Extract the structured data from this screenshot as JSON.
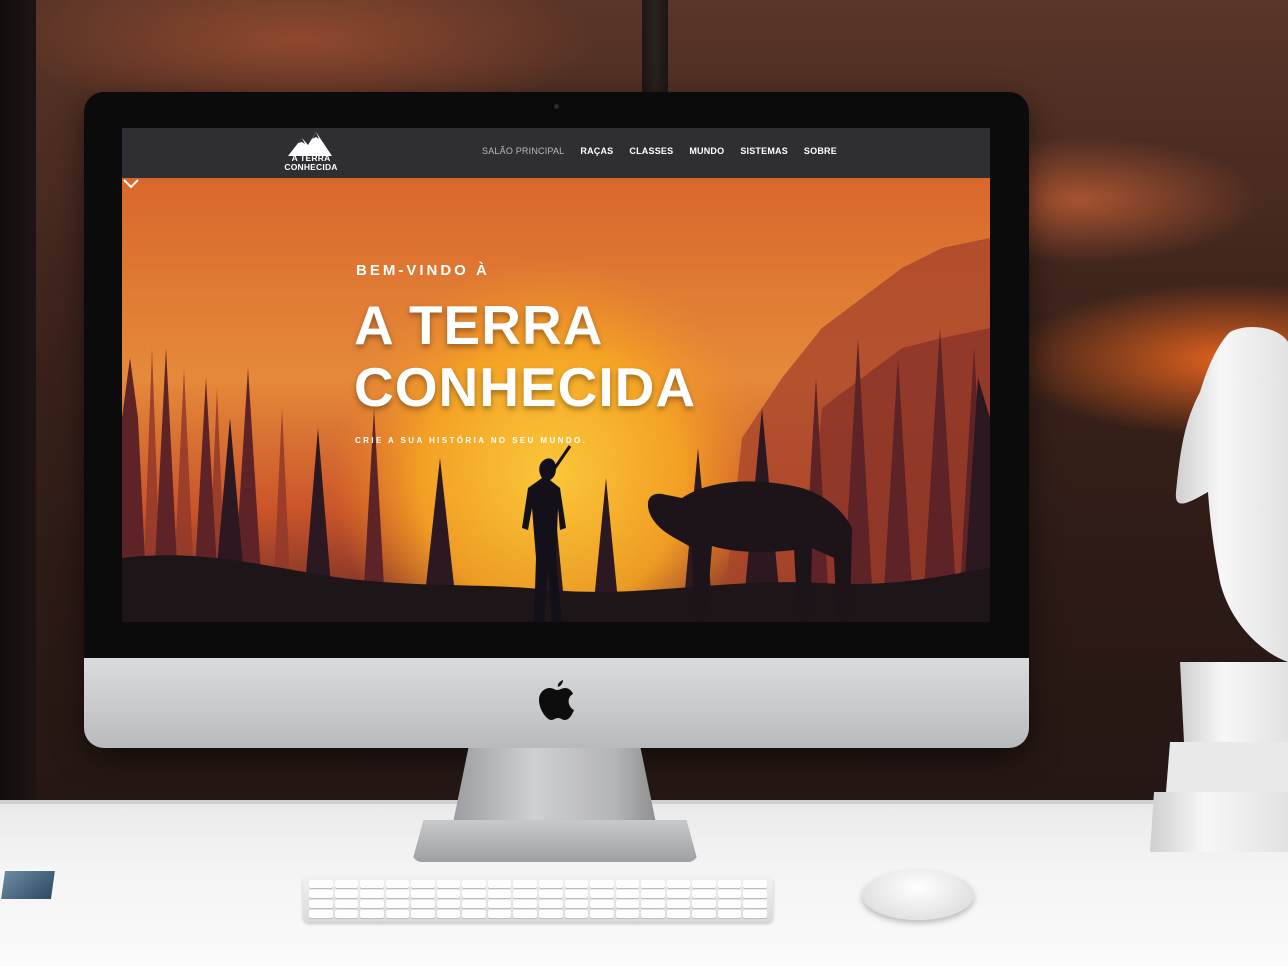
{
  "site": {
    "logo_text_line1": "A TERRA",
    "logo_text_line2": "CONHECIDA",
    "nav": [
      {
        "label": "SALÃO PRINCIPAL",
        "active": true
      },
      {
        "label": "RAÇAS"
      },
      {
        "label": "CLASSES"
      },
      {
        "label": "MUNDO"
      },
      {
        "label": "SISTEMAS"
      },
      {
        "label": "SOBRE"
      }
    ],
    "hero": {
      "pretitle": "BEM-VINDO À",
      "title_line1": "A TERRA",
      "title_line2": "CONHECIDA",
      "subtitle": "CRIE A SUA HISTÓRIA NO SEU MUNDO."
    }
  },
  "colors": {
    "navbar": "#2f2f33",
    "sky_orange": "#e07a30",
    "sun": "#f7b21e",
    "silhouette": "#2a1a22"
  },
  "icons": {
    "logo": "mountain-logo-icon",
    "scroll": "chevron-down-icon",
    "monitor_brand": "apple-logo-icon"
  }
}
